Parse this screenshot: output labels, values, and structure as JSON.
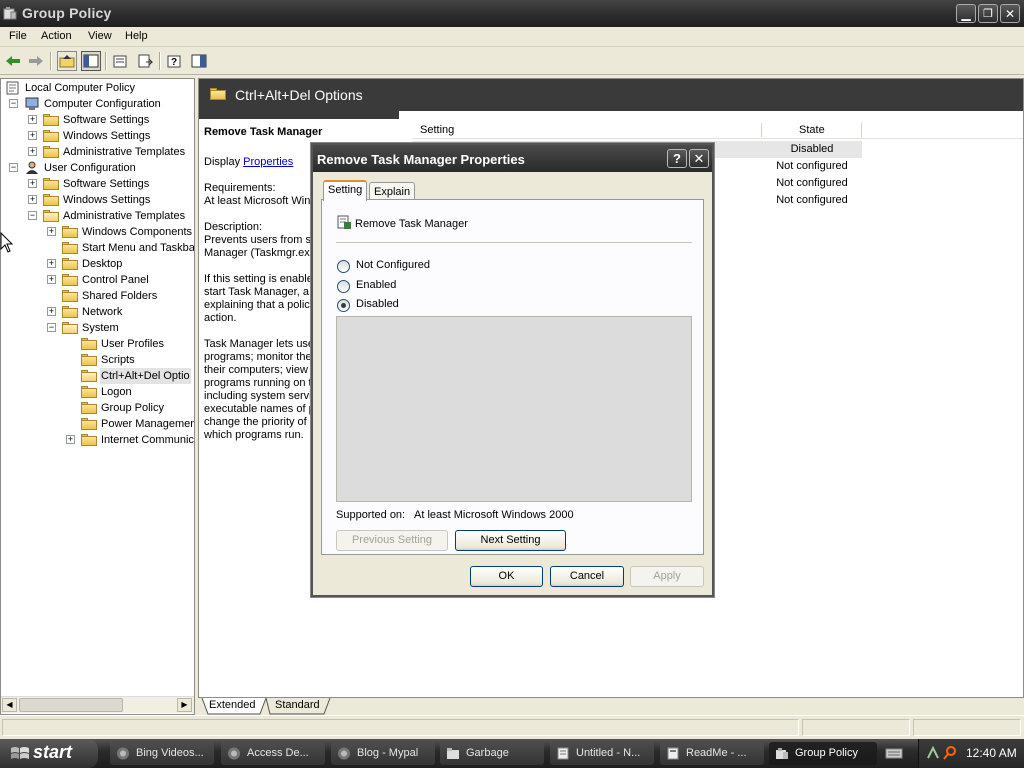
{
  "window": {
    "title": "Group Policy",
    "buttons": [
      "minimize",
      "maximize",
      "close"
    ]
  },
  "menu": [
    "File",
    "Action",
    "View",
    "Help"
  ],
  "toolbar": {
    "icons": [
      "back-icon",
      "forward-icon",
      "up-icon",
      "show-hide-tree-icon",
      "properties-icon",
      "export-list-icon",
      "help-icon",
      "show-hide-action-icon"
    ]
  },
  "tree": {
    "root": "Local Computer Policy",
    "items": [
      {
        "label": "Computer Configuration"
      },
      {
        "label": "Software Settings"
      },
      {
        "label": "Windows Settings"
      },
      {
        "label": "Administrative Templates"
      },
      {
        "label": "User Configuration"
      },
      {
        "label": "Software Settings"
      },
      {
        "label": "Windows Settings"
      },
      {
        "label": "Administrative Templates"
      },
      {
        "label": "Windows Components"
      },
      {
        "label": "Start Menu and Taskba"
      },
      {
        "label": "Desktop"
      },
      {
        "label": "Control Panel"
      },
      {
        "label": "Shared Folders"
      },
      {
        "label": "Network"
      },
      {
        "label": "System"
      },
      {
        "label": "User Profiles"
      },
      {
        "label": "Scripts"
      },
      {
        "label": "Ctrl+Alt+Del Optio"
      },
      {
        "label": "Logon"
      },
      {
        "label": "Group Policy"
      },
      {
        "label": "Power Managemen"
      },
      {
        "label": "Internet Communic"
      }
    ]
  },
  "right_pane": {
    "header_title": "Ctrl+Alt+Del Options",
    "setting_title": "Remove Task Manager",
    "display_prefix": "Display ",
    "display_link": "Properties",
    "requirements_label": "Requirements:",
    "requirements_value": "At least Microsoft Wind",
    "description_label": "Description:",
    "description_lines_1": [
      "Prevents users from s",
      "Manager (Taskmgr.exe"
    ],
    "description_lines_2": [
      "If this setting is enable",
      "start Task Manager, a",
      "explaining that a policy",
      "action."
    ],
    "description_lines_3": [
      "Task Manager lets use",
      "programs; monitor the",
      "their computers; view",
      "programs running on t",
      "including system servic",
      "executable names of p",
      "change the priority of",
      "which programs run."
    ],
    "columns": {
      "setting": "Setting",
      "state": "State"
    },
    "rows": [
      {
        "state": "Disabled"
      },
      {
        "state": "Not configured"
      },
      {
        "state": "Not configured"
      },
      {
        "state": "Not configured"
      }
    ],
    "view_tabs": [
      "Extended",
      "Standard"
    ]
  },
  "dialog": {
    "title": "Remove Task Manager Properties",
    "tabs": [
      "Setting",
      "Explain"
    ],
    "policy_name": "Remove Task Manager",
    "options": [
      "Not Configured",
      "Enabled",
      "Disabled"
    ],
    "selected": "Disabled",
    "supported_label": "Supported on:",
    "supported_value": "At least Microsoft Windows 2000",
    "prev_button": "Previous Setting",
    "next_button": "Next Setting",
    "ok": "OK",
    "cancel": "Cancel",
    "apply": "Apply"
  },
  "taskbar": {
    "start_label": "start",
    "tasks": [
      {
        "label": "Bing Videos..."
      },
      {
        "label": "Access De..."
      },
      {
        "label": "Blog - Mypal"
      },
      {
        "label": "Garbage"
      },
      {
        "label": "Untitled - N..."
      },
      {
        "label": "ReadMe - ..."
      },
      {
        "label": "Group Policy"
      }
    ],
    "clock": "12:40 AM"
  }
}
